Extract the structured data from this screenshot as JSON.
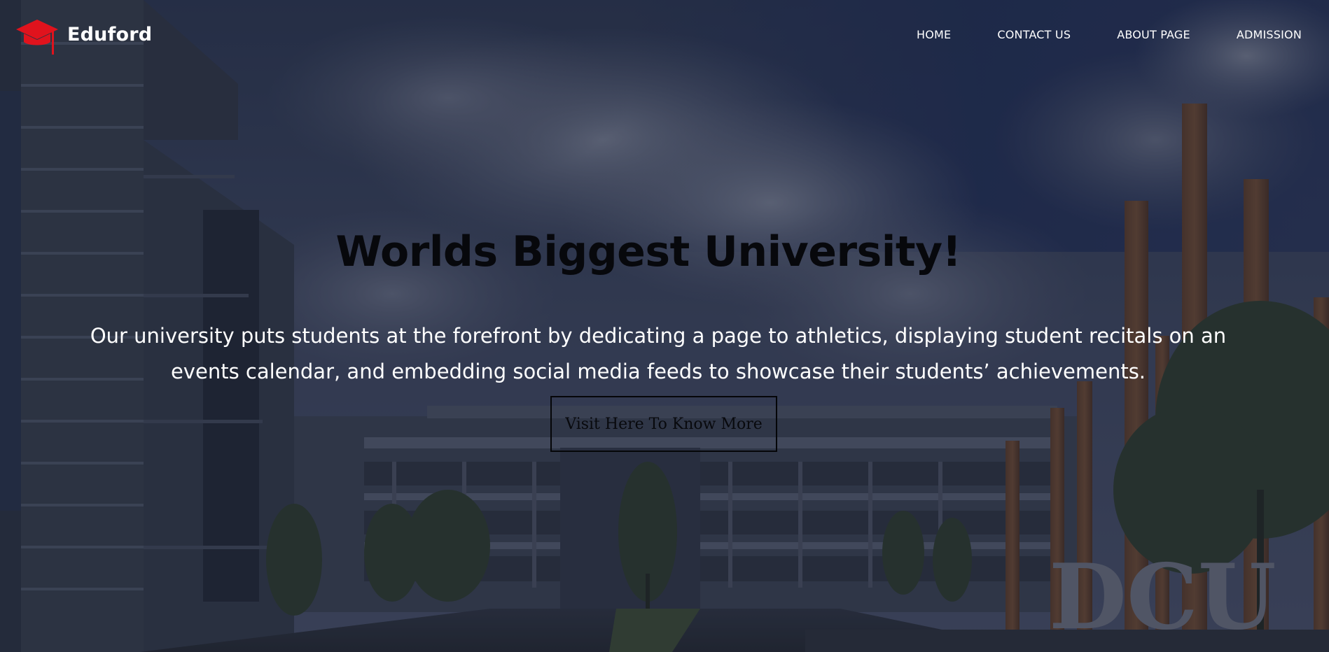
{
  "brand": {
    "name": "Eduford",
    "icon": "graduation-cap-icon",
    "icon_color": "#e0131d"
  },
  "nav": {
    "items": [
      {
        "label": "HOME"
      },
      {
        "label": "CONTACT US"
      },
      {
        "label": "ABOUT PAGE"
      },
      {
        "label": "ADMISSION"
      }
    ]
  },
  "hero": {
    "title": "Worlds Biggest University!",
    "description": "Our university puts students at the forefront by dedicating a page to athletics, displaying student recitals on an events calendar, and embedding social media feeds to showcase their students’ achievements.",
    "cta_label": "Visit Here To Know More",
    "sign_text": "DCU",
    "overlay_color": "#1c2333"
  }
}
